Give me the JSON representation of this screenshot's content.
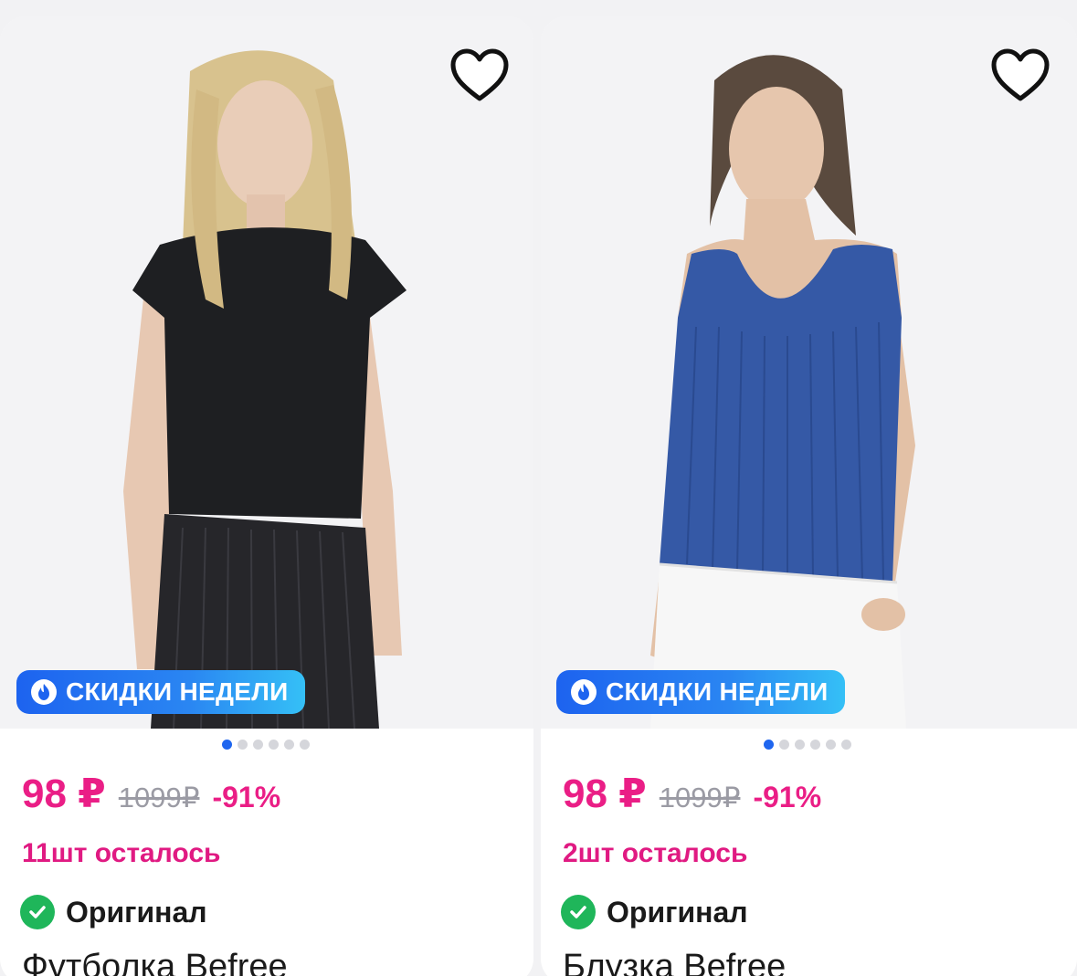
{
  "products": [
    {
      "badge": "СКИДКИ НЕДЕЛИ",
      "price": "98 ₽",
      "old_price": "1099₽",
      "discount": "-91%",
      "stock": "11шт осталось",
      "original": "Оригинал",
      "title": "Футболка Befree",
      "garment_color": "#1e1f22",
      "images_total": 6,
      "image_active": 1
    },
    {
      "badge": "СКИДКИ НЕДЕЛИ",
      "price": "98 ₽",
      "old_price": "1099₽",
      "discount": "-91%",
      "stock": "2шт осталось",
      "original": "Оригинал",
      "title": "Блузка Befree",
      "garment_color": "#3559a6",
      "images_total": 6,
      "image_active": 1
    }
  ],
  "icons": {
    "favorite": "heart-outline-icon",
    "badge": "flame-icon",
    "original": "check-circle-icon"
  },
  "colors": {
    "price": "#ea1e86",
    "stock": "#e01a82",
    "badge_start": "#1d63ef",
    "badge_end": "#35c0f6",
    "check": "#1fb65a",
    "active_dot": "#1f66ef"
  }
}
